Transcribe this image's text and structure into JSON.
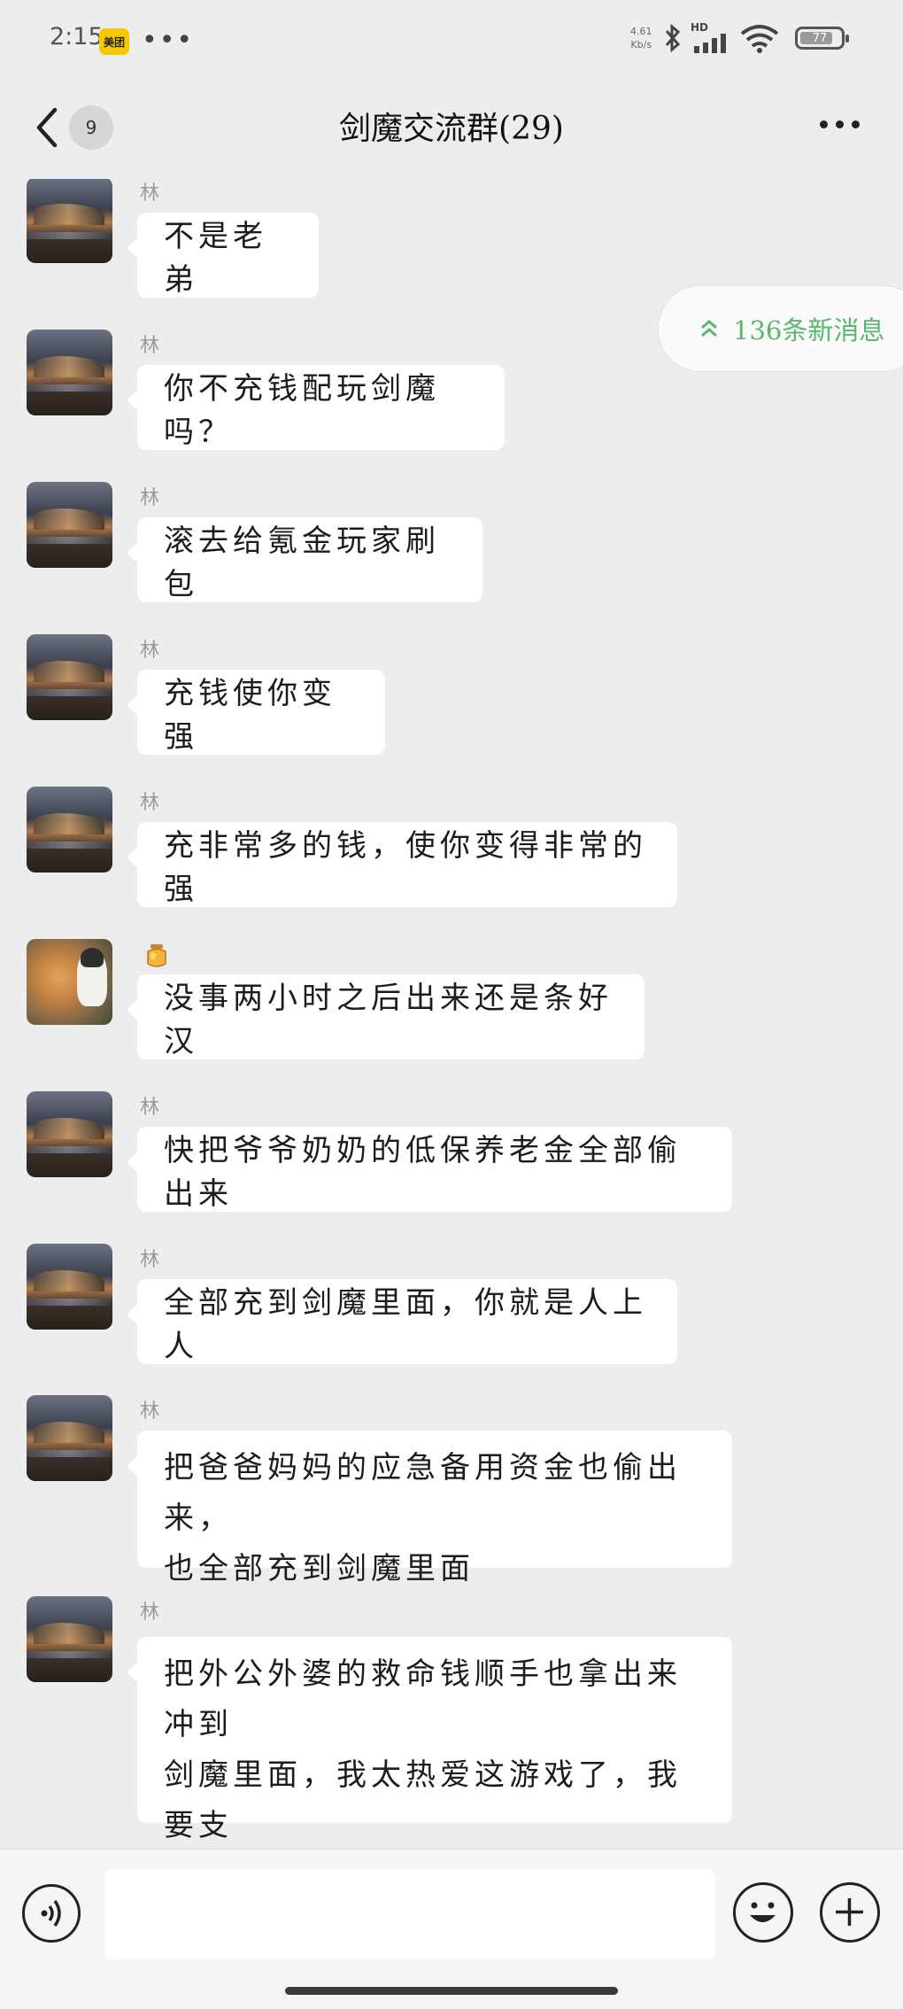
{
  "status_bar": {
    "time": "2:15",
    "app_badge": "美团",
    "dots": "•••",
    "net_speed_value": "4.61",
    "net_speed_unit": "Kb/s",
    "hd_label": "HD",
    "battery_level": "77"
  },
  "header": {
    "unread_count": "9",
    "title": "剑魔交流群(29)"
  },
  "new_messages_pill": {
    "label": "136条新消息",
    "accent_color": "#59b86d"
  },
  "messages": [
    {
      "sender": "林",
      "avatar": "mountain-landscape",
      "text": "不是老弟"
    },
    {
      "sender": "林",
      "avatar": "mountain-landscape",
      "text": "你不充钱配玩剑魔吗？"
    },
    {
      "sender": "林",
      "avatar": "mountain-landscape",
      "text": "滚去给氪金玩家刷包"
    },
    {
      "sender": "林",
      "avatar": "mountain-landscape",
      "text": "充钱使你变强"
    },
    {
      "sender": "林",
      "avatar": "mountain-landscape",
      "text": "充非常多的钱，使你变得非常的强"
    },
    {
      "sender_icon": "honey-jar-emoji",
      "avatar": "orange-cat",
      "text": "没事两小时之后出来还是条好汉"
    },
    {
      "sender": "林",
      "avatar": "mountain-landscape",
      "text": "快把爷爷奶奶的低保养老金全部偷出来"
    },
    {
      "sender": "林",
      "avatar": "mountain-landscape",
      "text": "全部充到剑魔里面，你就是人上人"
    },
    {
      "sender": "林",
      "avatar": "mountain-landscape",
      "text": "把爸爸妈妈的应急备用资金也偷出来，\n也全部充到剑魔里面"
    },
    {
      "sender": "林",
      "avatar": "mountain-landscape",
      "text": "把外公外婆的救命钱顺手也拿出来冲到\n剑魔里面，我太热爱这游戏了，我要支\n持这游戏"
    }
  ],
  "input_bar": {
    "placeholder": ""
  }
}
